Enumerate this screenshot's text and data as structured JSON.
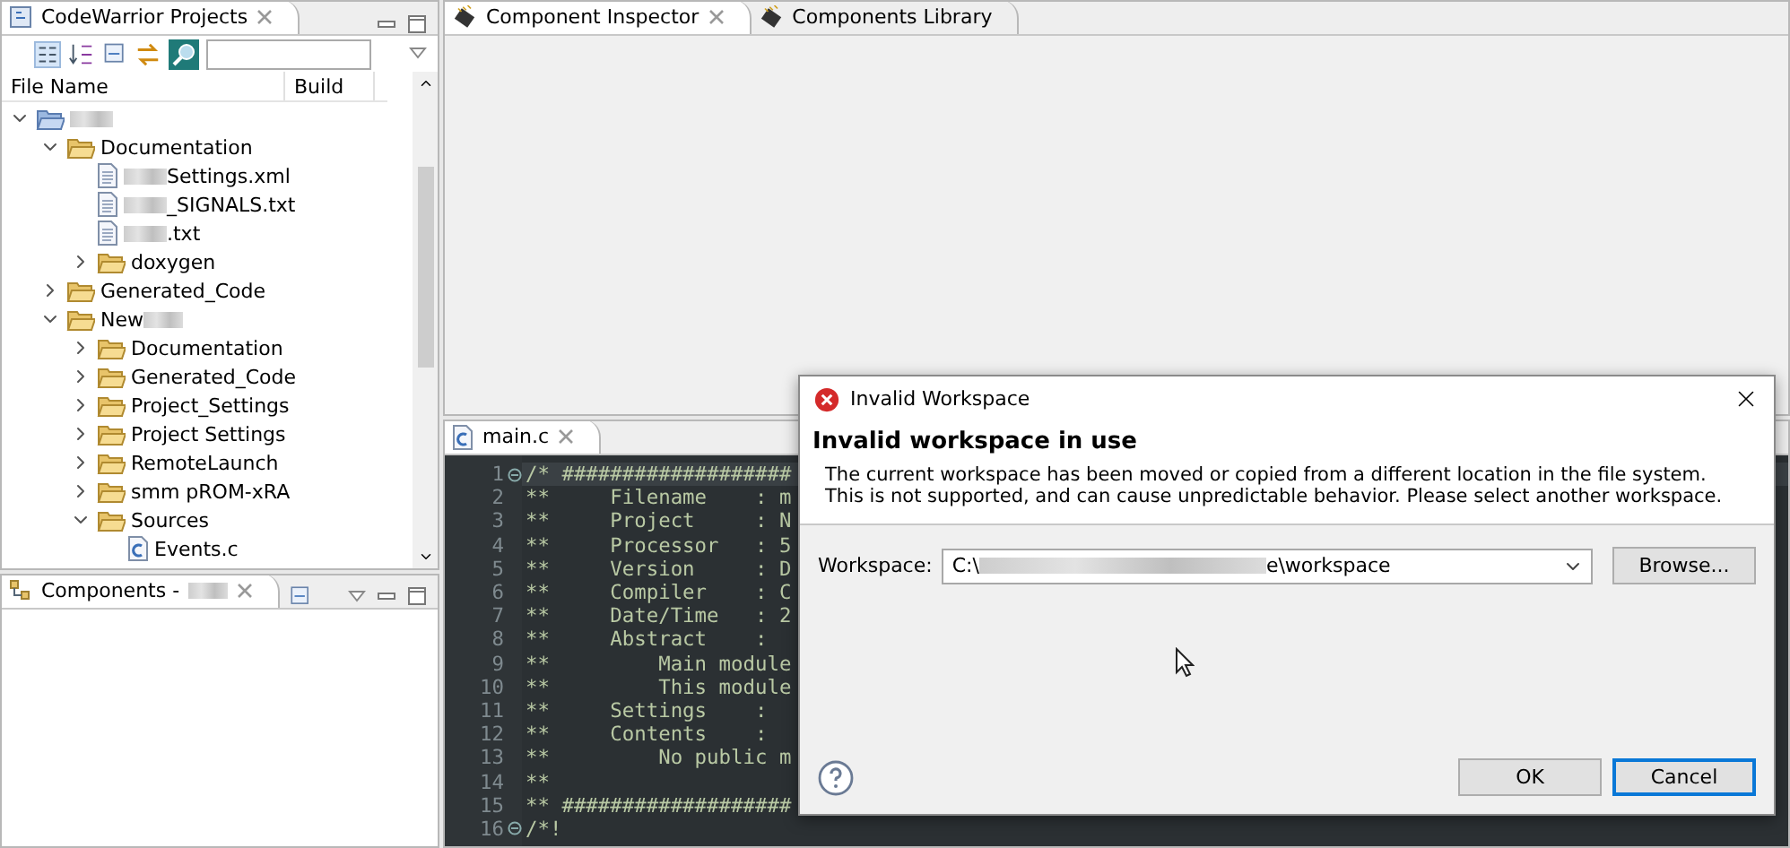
{
  "projects_panel": {
    "title": "CodeWarrior Projects",
    "columns": [
      "File Name",
      "Build"
    ],
    "tree": [
      {
        "kind": "project",
        "expanded": true,
        "blurred_before": true,
        "children": [
          {
            "kind": "folder",
            "label": "Documentation",
            "expanded": true,
            "children": [
              {
                "kind": "file",
                "label": "Settings.xml",
                "blurred_before": true
              },
              {
                "kind": "file",
                "label": "_SIGNALS.txt",
                "blurred_before": true
              },
              {
                "kind": "file",
                "label": ".txt",
                "blurred_before": true
              },
              {
                "kind": "folder",
                "label": "doxygen",
                "expanded": false
              }
            ]
          },
          {
            "kind": "folder",
            "label": "Generated_Code",
            "expanded": false
          },
          {
            "kind": "folder",
            "label": "New",
            "blurred_after": true,
            "expanded": true,
            "children": [
              {
                "kind": "folder",
                "label": "Documentation",
                "expanded": false
              },
              {
                "kind": "folder",
                "label": "Generated_Code",
                "expanded": false
              },
              {
                "kind": "folder",
                "label": "Project_Settings",
                "expanded": false
              },
              {
                "kind": "folder",
                "label": "Project Settings",
                "expanded": false
              },
              {
                "kind": "folder",
                "label": "RemoteLaunch",
                "expanded": false
              },
              {
                "kind": "folder",
                "label": "smm pROM-xRA",
                "expanded": false
              },
              {
                "kind": "folder",
                "label": "Sources",
                "expanded": true,
                "children": [
                  {
                    "kind": "c_file",
                    "label": "Events.c"
                  }
                ]
              }
            ]
          }
        ]
      }
    ]
  },
  "components_panel": {
    "title": "Components -",
    "blurred_after": true
  },
  "inspector_panel": {
    "tabs": [
      {
        "label": "Component Inspector",
        "selected": true
      },
      {
        "label": "Components Library",
        "selected": false
      }
    ]
  },
  "editor": {
    "tab": {
      "label": "main.c",
      "selected": true
    },
    "lines": [
      {
        "number": "1",
        "text": "/* ###################",
        "foldable": true
      },
      {
        "number": "2",
        "text": "**     Filename    : m",
        "foldable": false
      },
      {
        "number": "3",
        "text": "**     Project     : N",
        "foldable": false
      },
      {
        "number": "4",
        "text": "**     Processor   : 5",
        "foldable": false
      },
      {
        "number": "5",
        "text": "**     Version     : D",
        "foldable": false
      },
      {
        "number": "6",
        "text": "**     Compiler    : C",
        "foldable": false
      },
      {
        "number": "7",
        "text": "**     Date/Time   : 2",
        "foldable": false
      },
      {
        "number": "8",
        "text": "**     Abstract    :",
        "foldable": false
      },
      {
        "number": "9",
        "text": "**         Main module",
        "foldable": false
      },
      {
        "number": "10",
        "text": "**         This module",
        "foldable": false
      },
      {
        "number": "11",
        "text": "**     Settings    :",
        "foldable": false
      },
      {
        "number": "12",
        "text": "**     Contents    :",
        "foldable": false
      },
      {
        "number": "13",
        "text": "**         No public m",
        "foldable": false
      },
      {
        "number": "14",
        "text": "**",
        "foldable": false
      },
      {
        "number": "15",
        "text": "** ###################",
        "foldable": false
      },
      {
        "number": "16",
        "text": "/*!",
        "foldable": true
      }
    ]
  },
  "dialog": {
    "title": "Invalid Workspace",
    "heading": "Invalid workspace in use",
    "message": [
      "The current workspace has been moved or copied from a different location in the file system.",
      "This is not supported, and can cause unpredictable behavior.  Please select another workspace."
    ],
    "workspace": {
      "label": "Workspace:",
      "value_start": "C:\\",
      "value_end": "e\\workspace",
      "redacted": true
    },
    "browse": "Browse...",
    "buttons": [
      {
        "label": "OK",
        "focused": false
      },
      {
        "label": "Cancel",
        "focused": true
      }
    ]
  }
}
